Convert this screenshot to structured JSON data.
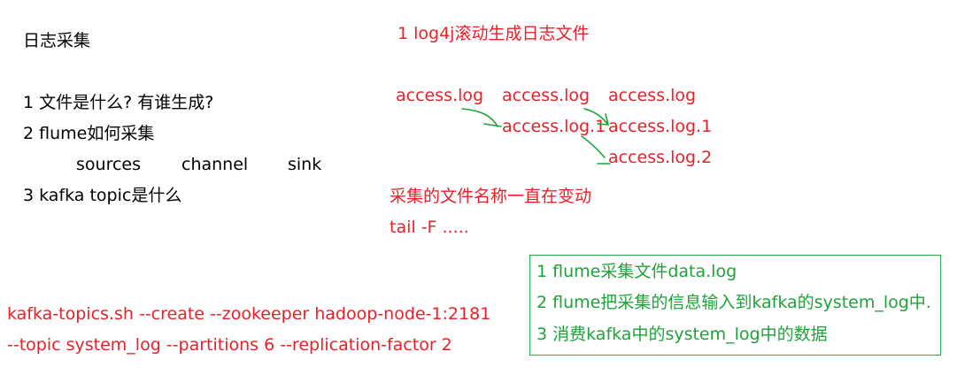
{
  "left_notes": {
    "title": "日志采集",
    "q1": "1 文件是什么? 有谁生成?",
    "q2": "2 flume如何采集",
    "components": {
      "sources": "sources",
      "channel": "channel",
      "sink": "sink"
    },
    "q3": "3 kafka   topic是什么"
  },
  "rolling": {
    "heading": "1 log4j滚动生成日志文件",
    "row1": [
      "access.log",
      "access.log",
      "access.log"
    ],
    "row2": [
      "access.log.1",
      "access.log.1"
    ],
    "row3": [
      "access.log.2"
    ],
    "note1": "采集的文件名称一直在变动",
    "note2": "tail -F ....."
  },
  "command": {
    "line1": "kafka-topics.sh --create --zookeeper hadoop-node-1:2181",
    "line2": "--topic system_log --partitions 6 --replication-factor 2"
  },
  "steps": [
    "1 flume采集文件data.log",
    "2 flume把采集的信息输入到kafka的system_log中.",
    "3 消费kafka中的system_log中的数据"
  ],
  "colors": {
    "red": "#e8202a",
    "green": "#1ea33a",
    "text": "#000000"
  }
}
